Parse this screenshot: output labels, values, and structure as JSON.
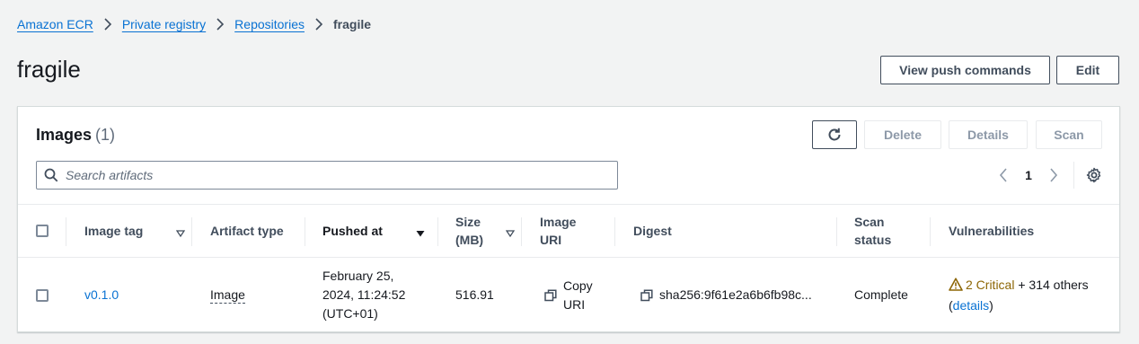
{
  "breadcrumb": {
    "items": [
      "Amazon ECR",
      "Private registry",
      "Repositories"
    ],
    "current": "fragile"
  },
  "header": {
    "title": "fragile",
    "view_push_label": "View push commands",
    "edit_label": "Edit"
  },
  "images": {
    "title": "Images",
    "count": "(1)",
    "actions": {
      "delete": "Delete",
      "details": "Details",
      "scan": "Scan"
    },
    "search": {
      "placeholder": "Search artifacts",
      "value": ""
    },
    "pagination": {
      "page": "1"
    },
    "columns": {
      "image_tag": "Image tag",
      "artifact_type": "Artifact type",
      "pushed_at": "Pushed at",
      "size_line1": "Size",
      "size_line2": "(MB)",
      "image_uri_line1": "Image",
      "image_uri_line2": "URI",
      "digest": "Digest",
      "scan_status_line1": "Scan",
      "scan_status_line2": "status",
      "vulnerabilities": "Vulnerabilities"
    },
    "rows": [
      {
        "image_tag": "v0.1.0",
        "artifact_type": "Image",
        "pushed_at_line1": "February 25,",
        "pushed_at_line2": "2024, 11:24:52",
        "pushed_at_line3": "(UTC+01)",
        "size": "516.91",
        "copy_uri_line1": "Copy",
        "copy_uri_line2": "URI",
        "digest": "sha256:9f61e2a6b6fb98c...",
        "scan_status": "Complete",
        "vuln_critical": "2 Critical",
        "vuln_others": " + 314 others",
        "vuln_open": "(",
        "vuln_details": "details",
        "vuln_close": ")"
      }
    ]
  },
  "colors": {
    "link": "#0972d3",
    "warning": "#8d6605",
    "background": "#f2f3f3"
  }
}
